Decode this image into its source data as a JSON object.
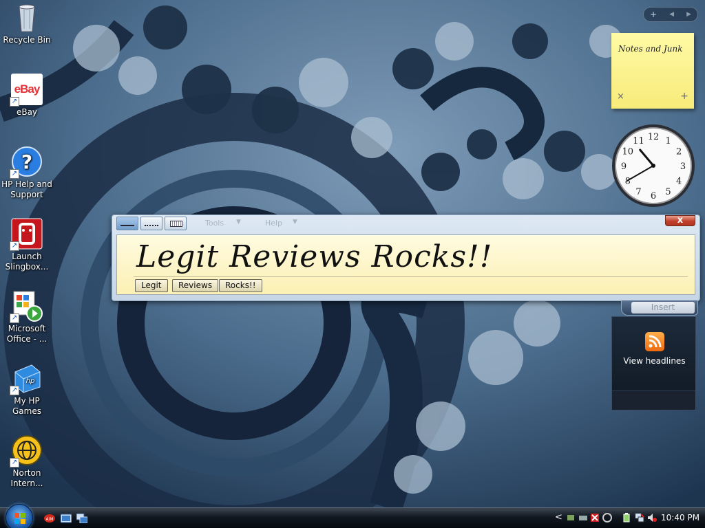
{
  "desktop": {
    "icons": [
      {
        "label": "Recycle Bin",
        "icon": "recycle-bin-icon"
      },
      {
        "label": "eBay",
        "icon": "ebay-icon",
        "logo_text": "eBay"
      },
      {
        "label": "HP Help and Support",
        "icon": "help-icon"
      },
      {
        "label": "Launch Slingbox...",
        "icon": "slingbox-icon"
      },
      {
        "label": "Microsoft Office - ...",
        "icon": "office-icon"
      },
      {
        "label": "My HP Games",
        "icon": "hp-games-icon"
      },
      {
        "label": "Norton Intern...",
        "icon": "norton-icon"
      }
    ]
  },
  "sidebar": {
    "note": {
      "text": "Notes and Junk",
      "delete_symbol": "×",
      "add_symbol": "+"
    },
    "controls": {
      "add_symbol": "+",
      "prev_symbol": "◀",
      "next_symbol": "▶"
    },
    "clock": {
      "hour": 10,
      "minute": 40
    },
    "feed": {
      "label": "View headlines",
      "icon": "rss-icon"
    }
  },
  "input_panel": {
    "menus": [
      "Tools",
      "Help"
    ],
    "ink_text": "Legit Reviews Rocks!!",
    "suggestions": [
      "Legit",
      "Reviews",
      "Rocks!!"
    ],
    "insert_label": "Insert",
    "close_symbol": "x"
  },
  "taskbar": {
    "clock": "10:40 PM",
    "tray_arrow": "<",
    "quick_launch": [
      "aim-icon",
      "show-desktop-icon",
      "switch-windows-icon"
    ],
    "tray_icons": [
      "network-icon",
      "security-icon",
      "battery-icon",
      "volume-muted-icon"
    ]
  },
  "colors": {
    "taskbar": "#111821",
    "note_yellow": "#fffaa5",
    "close_red": "#c0402a",
    "wallpaper_blue": "#3f5f7e"
  }
}
